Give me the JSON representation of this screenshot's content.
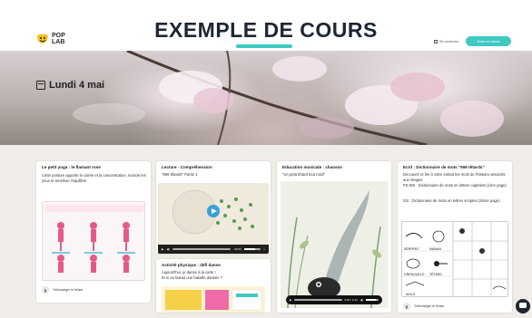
{
  "header": {
    "logo_line1": "POP",
    "logo_line2": "LAB",
    "title": "EXEMPLE DE COURS",
    "connect_label": "Se connecter",
    "try_label": "Tester en classe"
  },
  "hero": {
    "date": "Lundi 4 mai"
  },
  "cards": {
    "yoga": {
      "title": "Le petit yoga : le flamant rose",
      "desc": "Cette posture apporte le calme et la concentration, muscle les yeux et améliore l'équilibre",
      "download": "Télécharger le fichier"
    },
    "lecture": {
      "title": "Lecture - Compréhension",
      "subtitle": "\"999 têtards\" Partie 1",
      "video_time": "-00:53",
      "accent": "#3aa0d8"
    },
    "activite": {
      "title": "Activité physique : défi danse",
      "desc1": "Aujourd'hui, je danse à la carte !",
      "desc2": "Et si on faisait une bataille dansée ?"
    },
    "musique": {
      "title": "Education musicale : chanson",
      "subtitle": "\"Un petit têtard tout rond\"",
      "audio_time": "0:00 / 2:14"
    },
    "ecrit": {
      "title": "Ecrit : Dictionnaire de mots \"999 têtards\"",
      "desc": "Découvrir et lire à votre enfant les mots de l'histoire associés aux images",
      "ps_ms": "PS-MS : Dictionnaire de mots en lettres capitales (1ère page)",
      "gs": "GS : Dictionnaire de mots en lettres scriptes (2ème page)",
      "words": [
        "SERPENT",
        "MAMAN",
        "GRENOUILLE",
        "TÊTARD",
        "AIGLE"
      ],
      "download": "Télécharger le fichier"
    }
  },
  "colors": {
    "brand_teal": "#3ec9c2",
    "dark": "#1d2733"
  }
}
